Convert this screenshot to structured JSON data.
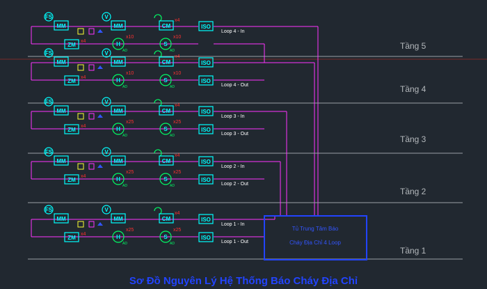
{
  "title": "Sơ Đồ Nguyên Lý Hệ Thống Báo Cháy Địa Chỉ",
  "panel": {
    "line1": "Tủ Trung Tâm Báo",
    "line2": "Cháy  Địa Chỉ 4 Loop"
  },
  "device_labels": {
    "fs": "FS",
    "v": "V",
    "mm": "MM",
    "zm": "ZM",
    "cm": "CM",
    "iso": "ISO",
    "h": "H",
    "s": "S",
    "ad": "AD"
  },
  "colors": {
    "background": "#212830",
    "wire": "#ff33ff",
    "device": "#00ffff",
    "device_alt": "#00ff66",
    "quantity": "#ff3030",
    "panel": "#2244ff",
    "floor_line": "#9aa0a6",
    "resistor": "#ffff33"
  },
  "floors": [
    {
      "name": "Tầng 5",
      "loop_in": "Loop 4 - In",
      "loop_out": "",
      "qty_cm": "x4",
      "qty_h": "x10",
      "qty_s": "x10",
      "qty_zm": "x4",
      "has_out_iso": false
    },
    {
      "name": "Tầng 4",
      "loop_in": "",
      "loop_out": "Loop 4 - Out",
      "qty_cm": "x4",
      "qty_h": "x10",
      "qty_s": "x10",
      "qty_zm": "x4",
      "has_out_iso": true
    },
    {
      "name": "Tầng 3",
      "loop_in": "Loop 3 - In",
      "loop_out": "Loop 3 - Out",
      "qty_cm": "x4",
      "qty_h": "x25",
      "qty_s": "x25",
      "qty_zm": "x4",
      "has_out_iso": true
    },
    {
      "name": "Tầng 2",
      "loop_in": "Loop 2 - In",
      "loop_out": "Loop 2 - Out",
      "qty_cm": "x4",
      "qty_h": "x25",
      "qty_s": "x25",
      "qty_zm": "x4",
      "has_out_iso": true
    },
    {
      "name": "Tầng 1",
      "loop_in": "Loop 1 - In",
      "loop_out": "Loop 1 - Out",
      "qty_cm": "x4",
      "qty_h": "x25",
      "qty_s": "x25",
      "qty_zm": "x4",
      "has_out_iso": true
    }
  ]
}
